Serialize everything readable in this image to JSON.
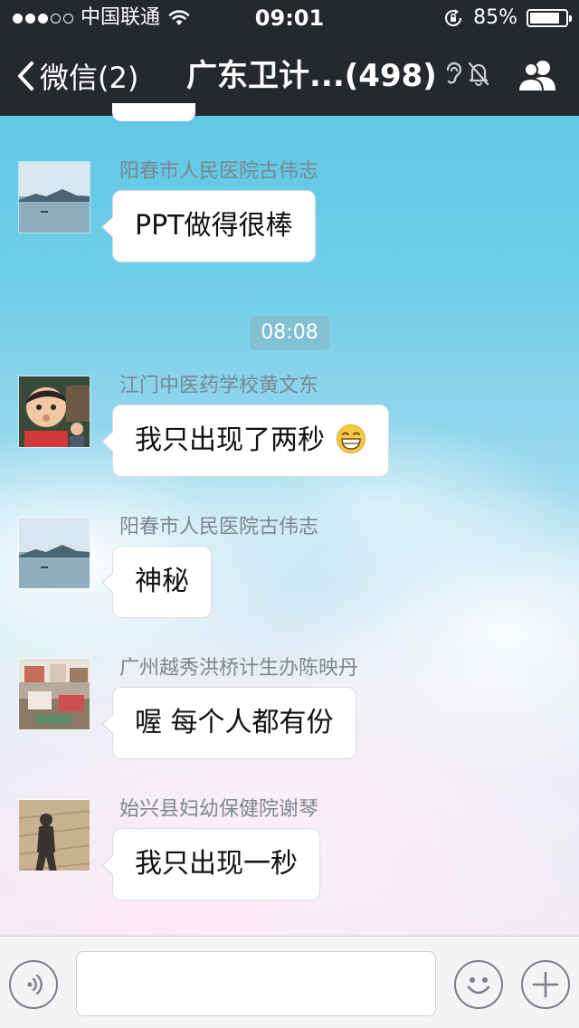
{
  "status_bar": {
    "carrier": "中国联通",
    "signal_strength": 3,
    "signal_max": 5,
    "time": "09:01",
    "battery_percent_label": "85%",
    "battery_level": 0.85
  },
  "nav": {
    "back_label": "微信(2)",
    "title": "广东卫计...(498)",
    "muted": true
  },
  "time_separator": "08:08",
  "messages": [
    {
      "sender": "阳春市人民医院古伟志",
      "text": "PPT做得很棒",
      "avatar": "lake-landscape"
    },
    {
      "sender": "江门中医药学校黄文东",
      "text": "我只出现了两秒",
      "emoji": "grinning-face-emoji",
      "avatar": "child-photo"
    },
    {
      "sender": "阳春市人民医院古伟志",
      "text": "神秘",
      "avatar": "lake-landscape"
    },
    {
      "sender": "广州越秀洪桥计生办陈映丹",
      "text": "喔 每个人都有份",
      "avatar": "room-photo"
    },
    {
      "sender": "始兴县妇幼保健院谢琴",
      "text": "我只出现一秒",
      "avatar": "shadow-photo"
    }
  ],
  "input_bar": {
    "voice_icon": "voice-icon",
    "input_value": "",
    "emoji_icon": "smiley-icon",
    "more_icon": "plus-icon"
  },
  "colors": {
    "header_bg": "#25282c",
    "bubble_bg": "#ffffff",
    "sender_text": "#7b8791",
    "sky_top": "#54c4e2"
  }
}
